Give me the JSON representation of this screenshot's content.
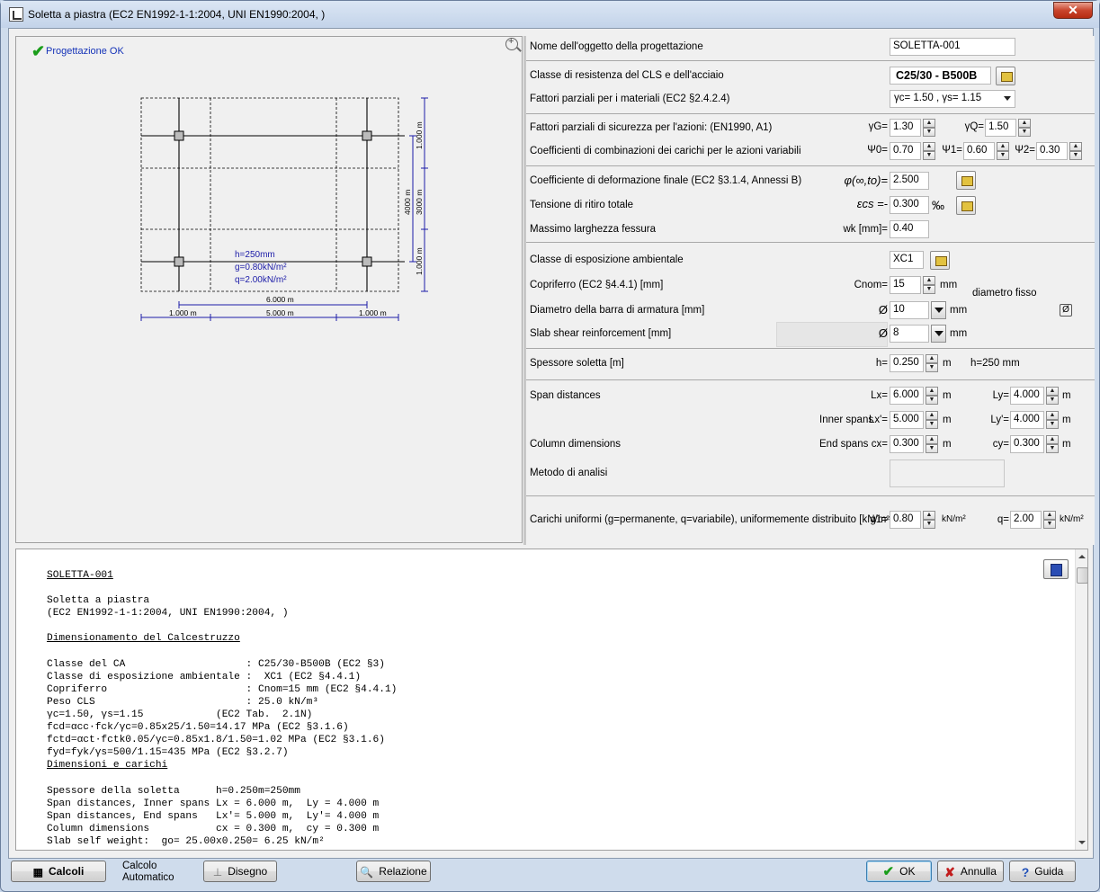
{
  "window": {
    "title": "Soletta a piastra (EC2 EN1992-1-1:2004, UNI EN1990:2004, )",
    "close_symbol": "✕"
  },
  "status": {
    "text": "Progettazione OK",
    "color": "#1a9d1a"
  },
  "drawing": {
    "slab_label_h": "h=250mm",
    "slab_label_g": "g=0.80kN/m²",
    "slab_label_q": "q=2.00kN/m²",
    "dim_total_x": "6.000 m",
    "dim_x_left": "1.000 m",
    "dim_x_mid": "5.000 m",
    "dim_x_right": "1.000 m",
    "dim_y_top": "1.000 m",
    "dim_y_total": "4000 m",
    "dim_y_mid": "3000 m",
    "dim_y_bottom": "1.000 m"
  },
  "form": {
    "object_name_label": "Nome dell'oggetto della progettazione",
    "object_name_value": "SOLETTA-001",
    "strength_class_label": "Classe di resistenza del CLS e dell'acciaio",
    "strength_class_value": "C25/30 - B500B",
    "material_factors_label": "Fattori parziali per i materiali (EC2 §2.4.2.4)",
    "material_factors_value": "γc= 1.50 , γs= 1.15",
    "safety_factors_label": "Fattori parziali di sicurezza per l'azioni: (EN1990, A1)",
    "gammaG_label": "γG=",
    "gammaG_value": "1.30",
    "gammaQ_label": "γQ=",
    "gammaQ_value": "1.50",
    "combination_label": "Coefficienti di combinazioni dei carichi per le azioni variabili",
    "psi0_label": "Ψ0=",
    "psi0_value": "0.70",
    "psi1_label": "Ψ1=",
    "psi1_value": "0.60",
    "psi2_label": "Ψ2=",
    "psi2_value": "0.30",
    "creep_label": "Coefficiente di deformazione finale (EC2 §3.1.4, Annessi B)",
    "creep_symbol": "φ(∞,tο)=",
    "creep_value": "2.500",
    "shrinkage_label": "Tensione di ritiro totale",
    "shrinkage_symbol": "εcs =-",
    "shrinkage_value": "0.300",
    "shrinkage_unit": "‰",
    "crack_label": "Massimo larghezza fessura",
    "crack_symbol": "wk [mm]=",
    "crack_value": "0.40",
    "exposure_label": "Classe di esposizione ambientale",
    "exposure_value": "XC1",
    "cover_label": "Copriferro (EC2 §4.4.1) [mm]",
    "cover_symbol": "Cnom=",
    "cover_value": "15",
    "cover_unit": "mm",
    "fixed_diameter_label": "diametro fisso",
    "bar_diameter_label": "Diametro della barra di armatura [mm]",
    "bar_diameter_symbol": "Ø",
    "bar_diameter_value": "10",
    "bar_diameter_unit": "mm",
    "fixed_diameter_icon": "Ø",
    "shear_label": "Slab shear reinforcement [mm]",
    "shear_symbol": "Ø",
    "shear_value": "8",
    "shear_unit": "mm",
    "thickness_label": "Spessore soletta [m]",
    "thickness_symbol": "h=",
    "thickness_value": "0.250",
    "thickness_unit": "m",
    "thickness_mm": "h=250 mm",
    "span_label": "Span distances",
    "lx_label": "Lx=",
    "lx_value": "6.000",
    "ly_label": "Ly=",
    "ly_value": "4.000",
    "inner_spans_label": "Inner spans",
    "lx1_label": "Lx'=",
    "lx1_value": "5.000",
    "ly1_label": "Ly'=",
    "ly1_value": "4.000",
    "column_label": "Column dimensions",
    "end_spans_label": "End spans",
    "cx_label": "cx=",
    "cx_value": "0.300",
    "cy_label": "cy=",
    "cy_value": "0.300",
    "method_label": "Metodo di analisi",
    "loads_label": "Carichi uniformi (g=permanente, q=variabile), uniformemente distribuito  [kN/m²]",
    "g1_label": "g1=",
    "g1_value": "0.80",
    "q_label": "q=",
    "q_value": "2.00",
    "unit_m": "m",
    "unit_kn": "kN/m²"
  },
  "report": {
    "title": "SOLETTA-001",
    "line1": "Soletta a piastra",
    "line2": "(EC2 EN1992-1-1:2004, UNI EN1990:2004, )",
    "section1": "Dimensionamento del Calcestruzzo",
    "body1": "Classe del CA                    : C25/30-B500B (EC2 §3)\nClasse di esposizione ambientale :  XC1 (EC2 §4.4.1)\nCopriferro                       : Cnom=15 mm (EC2 §4.4.1)\nPeso CLS                         : 25.0 kN/m³\nγc=1.50, γs=1.15            (EC2 Tab.  2.1N)\nfcd=αcc·fck/γc=0.85x25/1.50=14.17 MPa (EC2 §3.1.6)\nfctd=αct·fctk0.05/γc=0.85x1.8/1.50=1.02 MPa (EC2 §3.1.6)\nfyd=fyk/γs=500/1.15=435 MPa (EC2 §3.2.7)",
    "section2": "Dimensioni e carichi",
    "body2": "Spessore della soletta      h=0.250m=250mm\nSpan distances, Inner spans Lx = 6.000 m,  Ly = 4.000 m\nSpan distances, End spans   Lx'= 5.000 m,  Ly'= 4.000 m\nColumn dimensions           cx = 0.300 m,  cy = 0.300 m\nSlab self weight:  go= 25.00x0.250= 6.25 kN/m²"
  },
  "buttons": {
    "calc": "Calcoli",
    "auto_calc": "Calcolo\nAutomatico",
    "drawing": "Disegno",
    "report": "Relazione",
    "ok": "OK",
    "cancel": "Annulla",
    "help": "Guida"
  }
}
